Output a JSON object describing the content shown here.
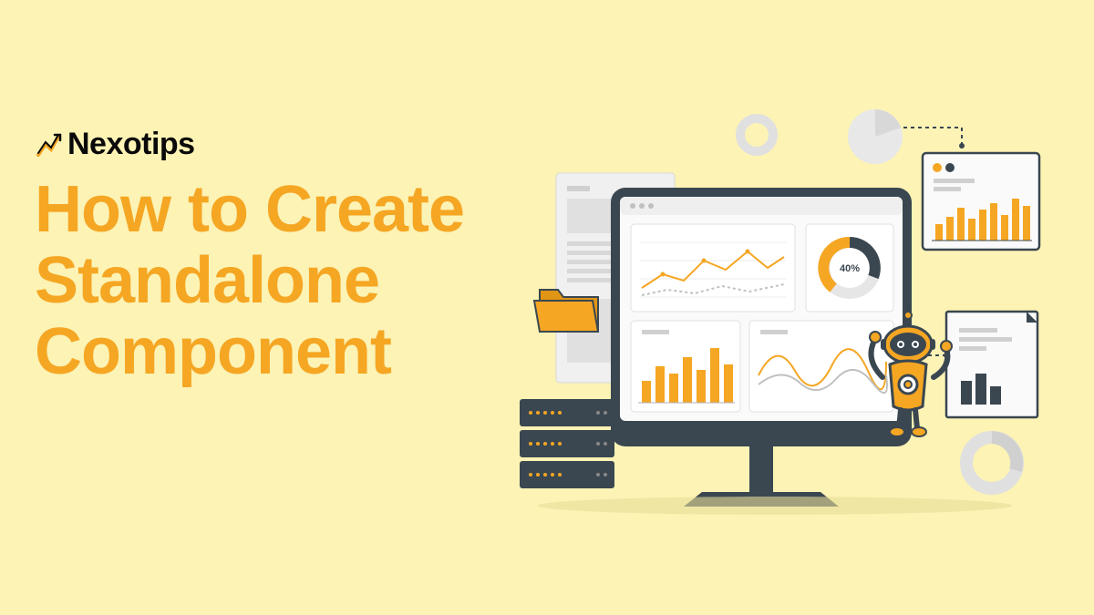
{
  "brand": {
    "name": "Nexotips"
  },
  "headline": {
    "line1": "How to Create",
    "line2": "Standalone",
    "line3": "Component"
  },
  "illustration": {
    "donut_label": "40%",
    "colors": {
      "accent": "#f5a623",
      "dark": "#3a4750",
      "light": "#e8e8e8",
      "bg": "#fcf3b5"
    }
  }
}
